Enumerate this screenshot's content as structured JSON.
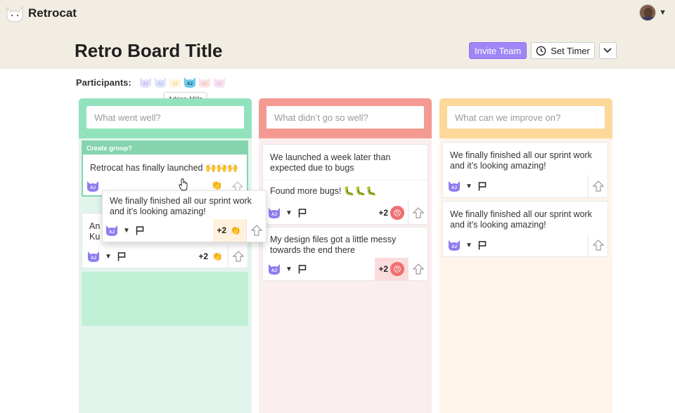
{
  "app": {
    "name": "Retrocat"
  },
  "user": {
    "avatar_icon": "user-avatar-photo"
  },
  "board": {
    "title": "Retro Board Title"
  },
  "actions": {
    "invite_label": "Invite Team",
    "timer_label": "Set Timer"
  },
  "participants": {
    "label": "Participants:",
    "avatars": [
      "AJ",
      "AJ",
      "AJ",
      "AJ",
      "AJ",
      "AJ"
    ],
    "tooltip": "Adrian Mills"
  },
  "columns": [
    {
      "placeholder": "What went well?",
      "color": "#92e3bd",
      "group_label": "Create group?",
      "cards": [
        {
          "text": "Retrocat has finally launched 🙌🙌🙌",
          "avatar": "AJ"
        },
        {
          "text": "An",
          "text2": "Ku",
          "avatar": "AJ",
          "votes": "+2"
        }
      ]
    },
    {
      "placeholder": "What didn’t go so well?",
      "color": "#f59a93",
      "cards": [
        {
          "text": "We launched a week later than expected due to bugs"
        },
        {
          "text": "Found more bugs! 🐛🐛🐛",
          "avatar": "AJ",
          "votes": "+2"
        },
        {
          "text": "My design files got a little messy towards the end there",
          "avatar": "AJ",
          "votes": "+2"
        }
      ]
    },
    {
      "placeholder": "What can we improve on?",
      "color": "#fcd899",
      "cards": [
        {
          "text": "We finally finished all our sprint work and it’s looking amazing!",
          "avatar": "AJ"
        },
        {
          "text": "We finally finished all our sprint work and it’s looking amazing!",
          "avatar": "AJ"
        }
      ]
    }
  ],
  "dragging_card": {
    "text": "We finally finished all our sprint work and it’s looking amazing!",
    "avatar": "AJ",
    "votes": "+2"
  }
}
